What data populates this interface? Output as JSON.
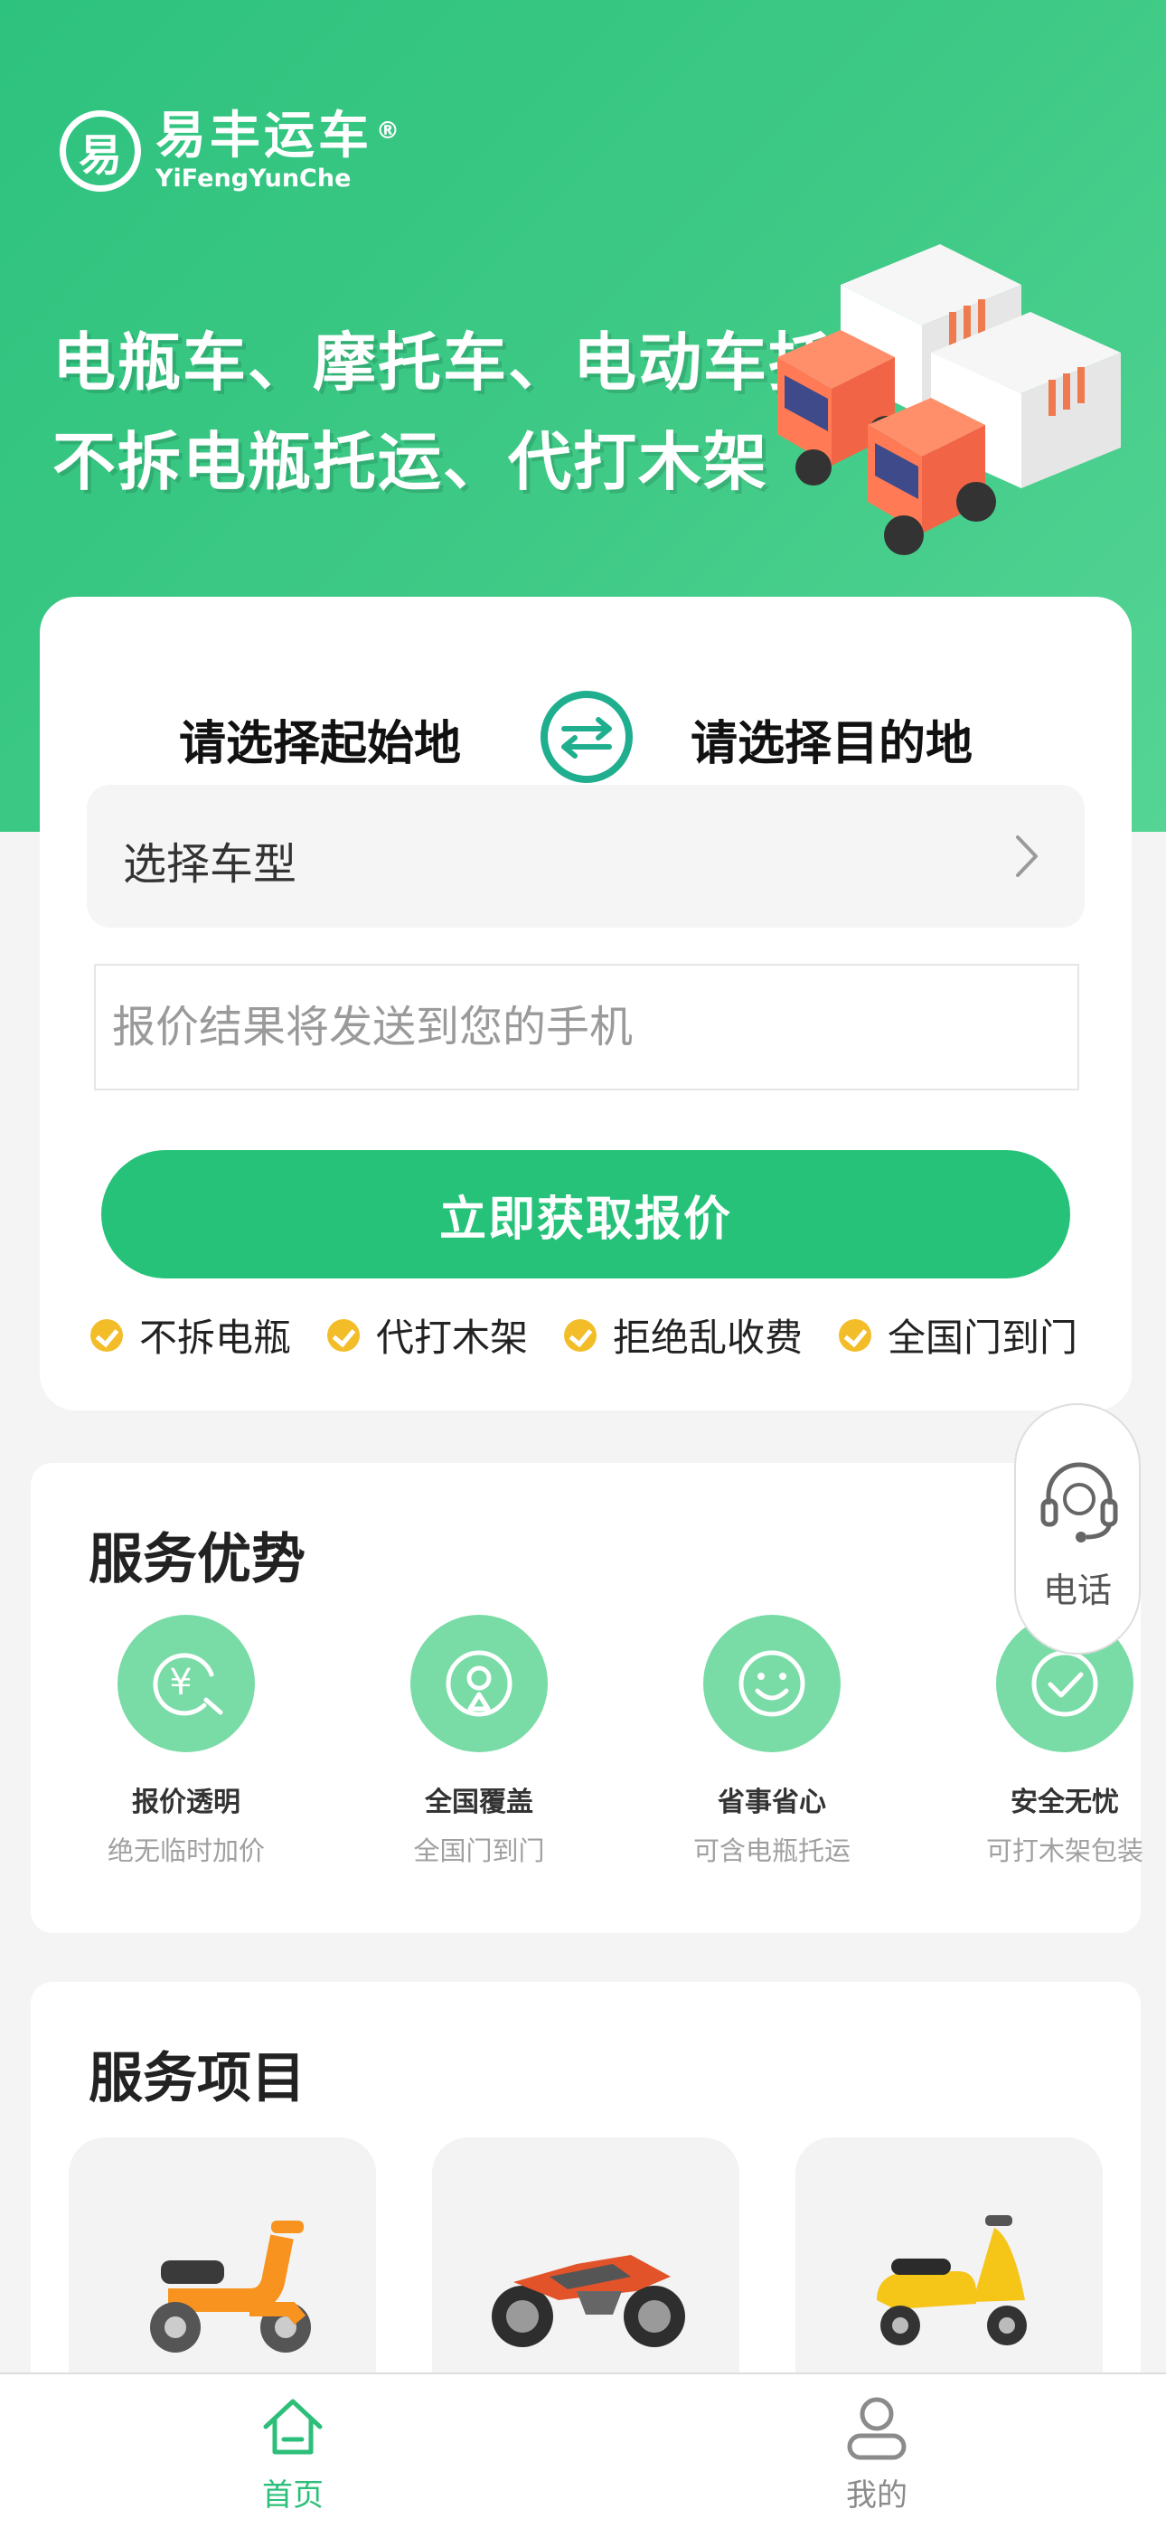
{
  "brand": {
    "name": "易丰运车",
    "pinyin": "YiFengYunChe",
    "registered": "®",
    "logo_glyph": "易"
  },
  "hero": {
    "slogan_line1": "电瓶车、摩托车、电动车托运",
    "slogan_line2": "不拆电瓶托运、代打木架"
  },
  "route": {
    "from_label": "请选择起始地",
    "to_label": "请选择目的地",
    "swap_icon": "swap-arrows-icon"
  },
  "form": {
    "vehicle_select_label": "选择车型",
    "phone_placeholder": "报价结果将发送到您的手机",
    "phone_value": "",
    "submit_label": "立即获取报价"
  },
  "features": [
    "不拆电瓶",
    "代打木架",
    "拒绝乱收费",
    "全国门到门"
  ],
  "advantages": {
    "title": "服务优势",
    "items": [
      {
        "title": "报价透明",
        "subtitle": "绝无临时加价",
        "icon": "yuan-icon"
      },
      {
        "title": "全国覆盖",
        "subtitle": "全国门到门",
        "icon": "location-pin-icon"
      },
      {
        "title": "省事省心",
        "subtitle": "可含电瓶托运",
        "icon": "smiley-icon"
      },
      {
        "title": "安全无忧",
        "subtitle": "可打木架包装",
        "icon": "check-circle-icon"
      }
    ]
  },
  "services": {
    "title": "服务项目",
    "items": [
      {
        "icon": "electric-scooter-icon"
      },
      {
        "icon": "motorcycle-icon"
      },
      {
        "icon": "vespa-scooter-icon"
      }
    ]
  },
  "float_call": {
    "label": "电话",
    "icon": "headset-icon"
  },
  "tabbar": {
    "home_label": "首页",
    "mine_label": "我的"
  },
  "colors": {
    "primary": "#26c279",
    "accent_check": "#f3bd2a",
    "icon_bg": "#79dba6"
  }
}
